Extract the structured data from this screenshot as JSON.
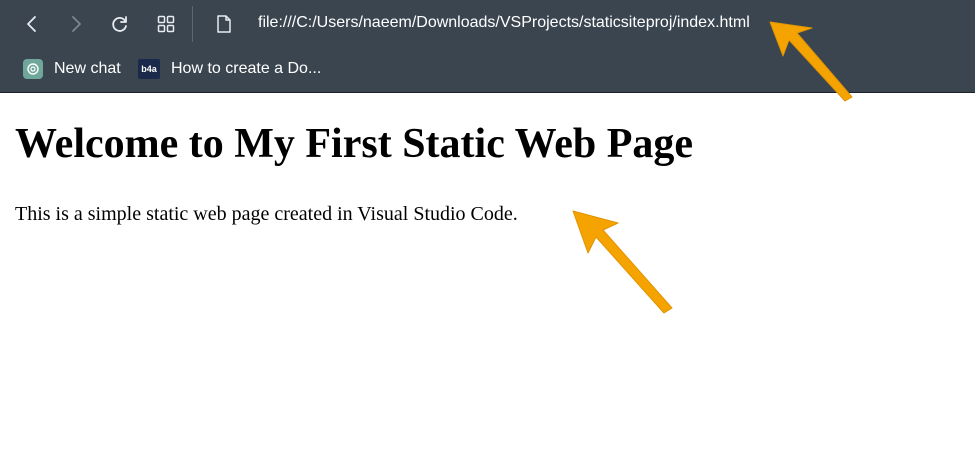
{
  "browser": {
    "address_bar": {
      "url": "file:///C:/Users/naeem/Downloads/VSProjects/staticsiteproj/index.html"
    },
    "nav_icons": [
      "back-icon",
      "forward-icon",
      "refresh-icon",
      "tab-groups-icon",
      "file-icon"
    ],
    "bookmarks": [
      {
        "label": "New chat",
        "icon": "chatgpt-icon"
      },
      {
        "label": "How to create a Do...",
        "icon": "b4a-icon",
        "icon_text": "b4a"
      }
    ]
  },
  "page": {
    "heading": "Welcome to My First Static Web Page",
    "paragraph": "This is a simple static web page created in Visual Studio Code."
  },
  "colors": {
    "toolbar": "#3a4550",
    "annotation_arrow": "#f5a300",
    "edge_accent": "#e31b2d"
  }
}
